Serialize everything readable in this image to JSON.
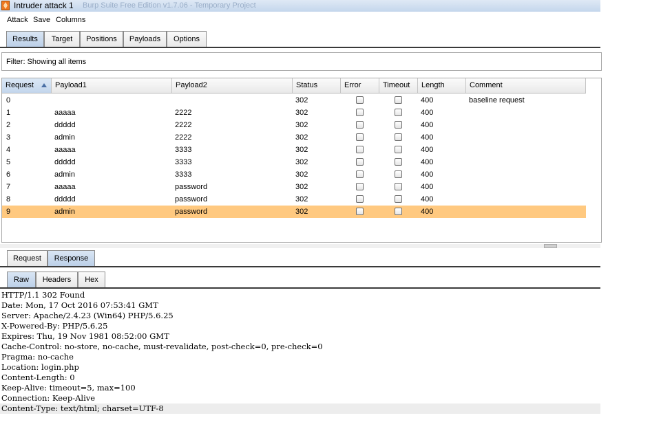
{
  "window": {
    "title": "Intruder attack 1",
    "ghost_title": "Burp Suite Free Edition v1.7.06 - Temporary Project"
  },
  "menu": [
    "Attack",
    "Save",
    "Columns"
  ],
  "main_tabs": [
    "Results",
    "Target",
    "Positions",
    "Payloads",
    "Options"
  ],
  "active_main_tab": "Results",
  "filter": {
    "text": "Filter: Showing all items"
  },
  "results_table": {
    "columns": [
      "Request",
      "Payload1",
      "Payload2",
      "Status",
      "Error",
      "Timeout",
      "Length",
      "Comment"
    ],
    "sorted_column": "Request",
    "rows": [
      {
        "request": "0",
        "payload1": "",
        "payload2": "",
        "status": "302",
        "error": false,
        "timeout": false,
        "length": "400",
        "comment": "baseline request"
      },
      {
        "request": "1",
        "payload1": "aaaaa",
        "payload2": "2222",
        "status": "302",
        "error": false,
        "timeout": false,
        "length": "400",
        "comment": ""
      },
      {
        "request": "2",
        "payload1": "ddddd",
        "payload2": "2222",
        "status": "302",
        "error": false,
        "timeout": false,
        "length": "400",
        "comment": ""
      },
      {
        "request": "3",
        "payload1": "admin",
        "payload2": "2222",
        "status": "302",
        "error": false,
        "timeout": false,
        "length": "400",
        "comment": ""
      },
      {
        "request": "4",
        "payload1": "aaaaa",
        "payload2": "3333",
        "status": "302",
        "error": false,
        "timeout": false,
        "length": "400",
        "comment": ""
      },
      {
        "request": "5",
        "payload1": "ddddd",
        "payload2": "3333",
        "status": "302",
        "error": false,
        "timeout": false,
        "length": "400",
        "comment": ""
      },
      {
        "request": "6",
        "payload1": "admin",
        "payload2": "3333",
        "status": "302",
        "error": false,
        "timeout": false,
        "length": "400",
        "comment": ""
      },
      {
        "request": "7",
        "payload1": "aaaaa",
        "payload2": "password",
        "status": "302",
        "error": false,
        "timeout": false,
        "length": "400",
        "comment": ""
      },
      {
        "request": "8",
        "payload1": "ddddd",
        "payload2": "password",
        "status": "302",
        "error": false,
        "timeout": false,
        "length": "400",
        "comment": ""
      },
      {
        "request": "9",
        "payload1": "admin",
        "payload2": "password",
        "status": "302",
        "error": false,
        "timeout": false,
        "length": "400",
        "comment": ""
      }
    ],
    "selected_request": "9"
  },
  "message_tabs": [
    "Request",
    "Response"
  ],
  "active_message_tab": "Response",
  "view_tabs": [
    "Raw",
    "Headers",
    "Hex"
  ],
  "active_view_tab": "Raw",
  "response_lines": [
    "HTTP/1.1 302 Found",
    "Date: Mon, 17 Oct 2016 07:53:41 GMT",
    "Server: Apache/2.4.23 (Win64) PHP/5.6.25",
    "X-Powered-By: PHP/5.6.25",
    "Expires: Thu, 19 Nov 1981 08:52:00 GMT",
    "Cache-Control: no-store, no-cache, must-revalidate, post-check=0, pre-check=0",
    "Pragma: no-cache",
    "Location: login.php",
    "Content-Length: 0",
    "Keep-Alive: timeout=5, max=100",
    "Connection: Keep-Alive",
    "Content-Type: text/html; charset=UTF-8"
  ],
  "colors": {
    "selected_row": "#ffc980",
    "active_tab": "#c8d9ee",
    "app_icon": "#f07820"
  },
  "icons": [
    "burp-app-icon",
    "sort-ascending-icon"
  ]
}
